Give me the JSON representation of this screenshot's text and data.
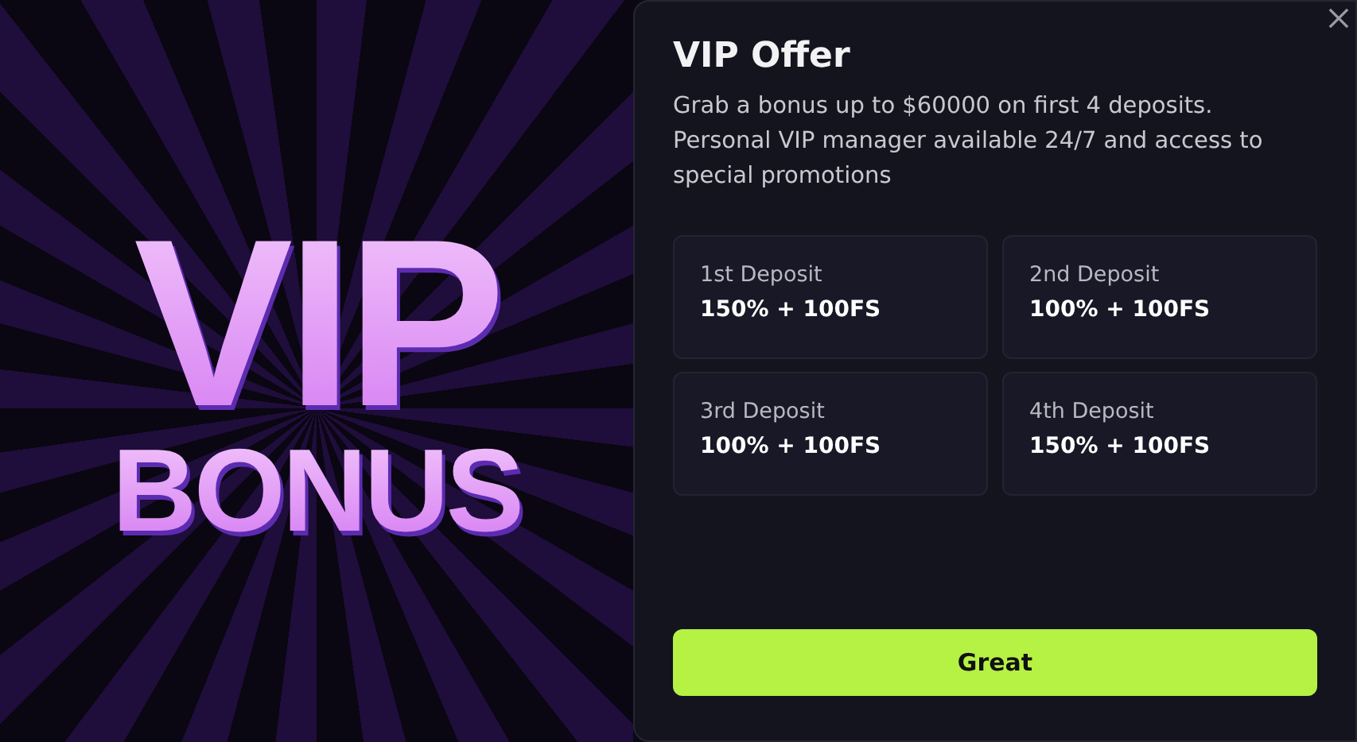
{
  "banner": {
    "line_1": "VIP",
    "line_2": "BONUS"
  },
  "dialog": {
    "title": "VIP Offer",
    "description": "Grab a bonus up to $60000 on first 4 deposits. Personal VIP manager available 24/7 and access to special promotions",
    "deposits": [
      {
        "label": "1st Deposit",
        "value": "150% + 100FS"
      },
      {
        "label": "2nd Deposit",
        "value": "100% + 100FS"
      },
      {
        "label": "3rd Deposit",
        "value": "100% + 100FS"
      },
      {
        "label": "4th Deposit",
        "value": "150% + 100FS"
      }
    ],
    "button": "Great"
  }
}
